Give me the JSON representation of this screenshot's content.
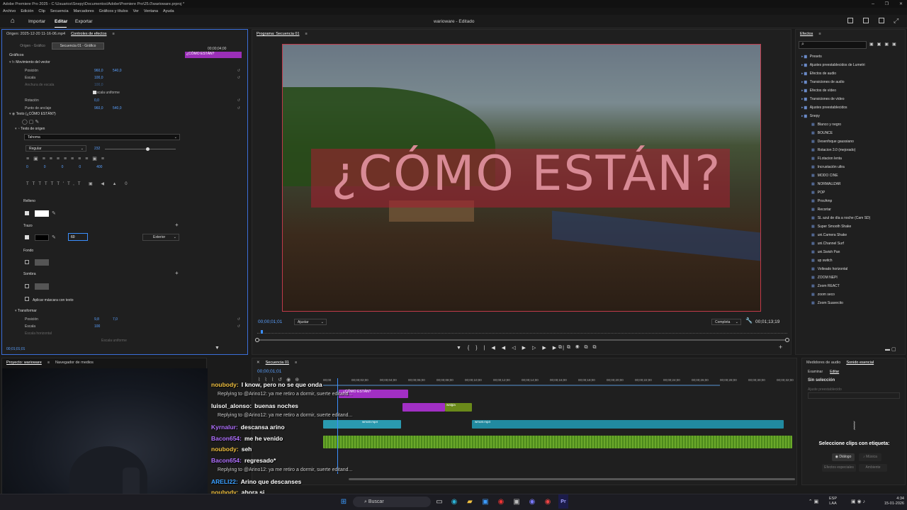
{
  "titlebar": {
    "text": "Adobe Premiere Pro 2025 - C:\\Usuarios\\Snepy\\Documentos\\Adobe\\Premiere Pro\\25.0\\warioware.prproj *",
    "min": "–",
    "max": "❐",
    "close": "✕"
  },
  "menu": [
    "Archivo",
    "Edición",
    "Clip",
    "Secuencia",
    "Marcadores",
    "Gráficos y títulos",
    "Ver",
    "Ventana",
    "Ayuda"
  ],
  "workspace": {
    "home": "⌂",
    "tabs": [
      "Importar",
      "Editar",
      "Exportar"
    ],
    "active": "Editar",
    "project_title": "warioware - Editado"
  },
  "effect_controls": {
    "source_tab": "Origen: 2025-12-20 11-16-06.mp4",
    "active_tab": "Controles de efectos",
    "origin_btn": "Origen - Gráfico",
    "seq_btn": "Secuencia 01 - Gráfico",
    "time_ruler": "00;00;04;00",
    "clip_label": "¿CÓMO ESTÁN?",
    "section": "Gráficos",
    "vector_motion": "Movimiento del vector",
    "rows": [
      {
        "label": "Posición",
        "v1": "960,0",
        "v2": "540,0"
      },
      {
        "label": "Escala",
        "v1": "100,0",
        "v2": ""
      },
      {
        "label": "Anchura de escala",
        "v1": "100,0",
        "v2": ""
      },
      {
        "label": "Escala uniforme",
        "v1": "",
        "v2": ""
      },
      {
        "label": "Rotación",
        "v1": "0,0",
        "v2": ""
      },
      {
        "label": "Punto de anclaje",
        "v1": "960,0",
        "v2": "540,0"
      }
    ],
    "text_layer": "Texto (¿CÓMO ESTÁN?)",
    "source_text": "Texto de origen",
    "font": "Tahoma",
    "style": "Regular",
    "size": "232",
    "tracking": [
      "0",
      "0",
      "0",
      "0",
      "400"
    ],
    "relleno": "Relleno",
    "trazo": "Trazo",
    "stroke_val": "60",
    "stroke_pos": "Exterior",
    "fondo": "Fondo",
    "sombra": "Sombra",
    "mask": "Aplicar máscara con texto",
    "transformer": "Transformar",
    "t_rows": [
      {
        "label": "Posición",
        "v1": "9,8",
        "v2": "7,0"
      },
      {
        "label": "Escala",
        "v1": "100",
        "v2": ""
      },
      {
        "label": "Escala horizontal",
        "v1": "",
        "v2": ""
      },
      {
        "label": "Escala uniforme",
        "v1": "",
        "v2": ""
      }
    ],
    "timecode": "00;01;01;01"
  },
  "program": {
    "tab": "Programa: Secuencia 01",
    "overlay_text": "¿CÓMO ESTÁN?",
    "timecode": "00;00;01;01",
    "fit": "Ajustar",
    "quality": "Completa",
    "duration": "00;01;13;19"
  },
  "effects": {
    "tab": "Efectos",
    "items": [
      {
        "t": "Presets",
        "f": true,
        "d": 0
      },
      {
        "t": "Ajustes preestablecidos de Lumetri",
        "f": true,
        "d": 0
      },
      {
        "t": "Efectos de audio",
        "f": true,
        "d": 0
      },
      {
        "t": "Transiciones de audio",
        "f": true,
        "d": 0
      },
      {
        "t": "Efectos de vídeo",
        "f": true,
        "d": 0
      },
      {
        "t": "Transiciones de vídeo",
        "f": true,
        "d": 0
      },
      {
        "t": "Ajustes preestablecidos",
        "f": true,
        "d": 0
      },
      {
        "t": "Snepy",
        "f": true,
        "d": 0
      },
      {
        "t": "Blanco y negro",
        "f": false,
        "d": 1
      },
      {
        "t": "BOUNCE",
        "f": false,
        "d": 1
      },
      {
        "t": "Desenfoque gaussiano",
        "f": false,
        "d": 1
      },
      {
        "t": "Rotacion 3.0 (mejorado)",
        "f": false,
        "d": 1
      },
      {
        "t": "FLotacion lenta",
        "f": false,
        "d": 1
      },
      {
        "t": "Incrustación ultra",
        "f": false,
        "d": 1
      },
      {
        "t": "MODO CINE",
        "f": false,
        "d": 1
      },
      {
        "t": "NORMALIZAR",
        "f": false,
        "d": 1
      },
      {
        "t": "POP",
        "f": false,
        "d": 1
      },
      {
        "t": "ProcAmp",
        "f": false,
        "d": 1
      },
      {
        "t": "Recortar",
        "f": false,
        "d": 1
      },
      {
        "t": "SL azul de día a noche (Cam SD)",
        "f": false,
        "d": 1
      },
      {
        "t": "Super Smooth Shake",
        "f": false,
        "d": 1
      },
      {
        "t": "uni.Camera Shake",
        "f": false,
        "d": 1
      },
      {
        "t": "uni.Channel Surf",
        "f": false,
        "d": 1
      },
      {
        "t": "uni.Swish Pan",
        "f": false,
        "d": 1
      },
      {
        "t": "up switch",
        "f": false,
        "d": 1
      },
      {
        "t": "Volteado horizontal",
        "f": false,
        "d": 1
      },
      {
        "t": "ZOOM NEPI",
        "f": false,
        "d": 1
      },
      {
        "t": "Zoom REACT",
        "f": false,
        "d": 1
      },
      {
        "t": "zoom seco",
        "f": false,
        "d": 1
      },
      {
        "t": "Zoom Suavecito",
        "f": false,
        "d": 1
      }
    ]
  },
  "project": {
    "tab": "Proyecto: warioware",
    "tab2": "Navegador de medios"
  },
  "sequence": {
    "tab": "Secuencia 01",
    "timecode": "00;00;01;01",
    "ruler": [
      "00;00",
      "00;00;02;00",
      "00;00;04;00",
      "00;00;06;00",
      "00;00;08;00",
      "00;00;10;00",
      "00;00;12;00",
      "00;00;14;00",
      "00;00;16;00",
      "00;00;18;00",
      "00;00;20;00",
      "00;00;22;00",
      "00;00;24;00",
      "00;00;26;00",
      "00;00;28;00",
      "00;00;30;00",
      "00;00;32;00"
    ],
    "clip_title": "¿CÓMO ESTÁN?",
    "clip_video": "wmotr.mp4",
    "clip_video2": "wmotr.mp4",
    "clip_small": "walgia"
  },
  "audio_panel": {
    "tab1": "Medidores de audio",
    "tab2": "Sonido esencial",
    "sub1": "Examinar",
    "sub2": "Editar",
    "nosel": "Sin selección",
    "preset": "Ajuste preestablecido",
    "hint": "Seleccione clips con etiqueta:",
    "dialog": "Diálogo",
    "music": "Música",
    "sfx": "Efectos especiales",
    "amb": "Ambiente"
  },
  "chat": [
    {
      "user": "noubody:",
      "msg": "I know, pero no se que onda",
      "color": "#f0c040"
    },
    {
      "reply": "Replying to @Arino12: ya me retiro a dormir, suerte editand..."
    },
    {
      "user": "luisol_alonso:",
      "msg": "buenas noches",
      "color": "#ffffff"
    },
    {
      "reply": "Replying to @Arino12: ya me retiro a dormir, suerte editand..."
    },
    {
      "user": "Kyrnalur:",
      "msg": "descansa arino",
      "color": "#b070ff"
    },
    {
      "user": "Bacon654:",
      "msg": "me he venido",
      "color": "#b070ff"
    },
    {
      "user": "noubody:",
      "msg": "seh",
      "color": "#f0c040"
    },
    {
      "user": "Bacon654:",
      "msg": "regresado*",
      "color": "#b070ff"
    },
    {
      "reply": "Replying to @Arino12: ya me retiro a dormir, suerte editand..."
    },
    {
      "user": "ARELI22:",
      "msg": "Arino que descanses",
      "color": "#3aa0ff"
    },
    {
      "user": "noubody:",
      "msg": "ahora si",
      "color": "#f0c040"
    }
  ],
  "taskbar": {
    "search": "Buscar",
    "lang1": "ESP",
    "lang2": "LAA",
    "time": "4:34",
    "date": "15-01-2026"
  }
}
